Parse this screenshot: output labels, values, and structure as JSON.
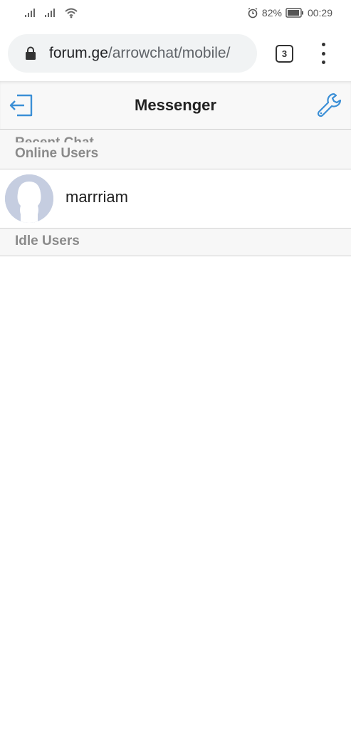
{
  "status_bar": {
    "battery": "82%",
    "time": "00:29"
  },
  "browser": {
    "url_host": "forum.ge",
    "url_path": "/arrowchat/mobile/",
    "tab_count": "3"
  },
  "header": {
    "title": "Messenger"
  },
  "sections": {
    "recent_label": "Recent Chat",
    "online_label": "Online Users",
    "idle_label": "Idle Users"
  },
  "online_users": [
    {
      "name": "marrriam"
    }
  ],
  "colors": {
    "accent": "#3b8fd6",
    "section_text": "#8a8a8a",
    "avatar_bg": "#c5cde0"
  }
}
